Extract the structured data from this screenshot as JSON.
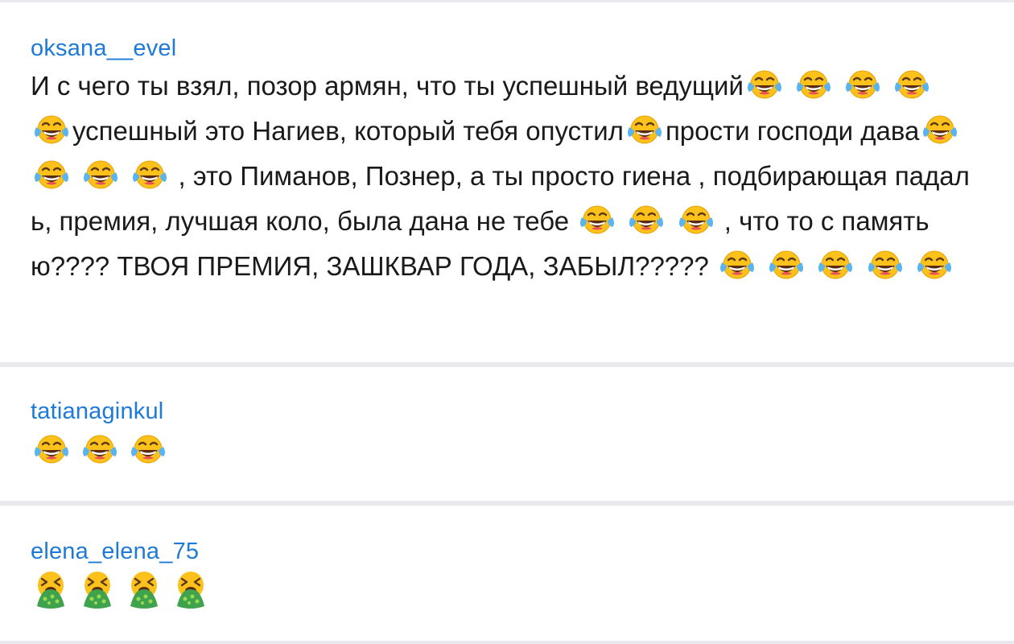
{
  "comments": [
    {
      "username": "oksana__evel",
      "segments": [
        {
          "t": "text",
          "v": "И с чего ты взял, позор армян, что ты успешный ведущий"
        },
        {
          "t": "emoji",
          "v": "face-with-tears-of-joy"
        },
        {
          "t": "text",
          "v": " "
        },
        {
          "t": "emoji",
          "v": "face-with-tears-of-joy"
        },
        {
          "t": "text",
          "v": " "
        },
        {
          "t": "emoji",
          "v": "face-with-tears-of-joy"
        },
        {
          "t": "text",
          "v": " "
        },
        {
          "t": "emoji",
          "v": "face-with-tears-of-joy"
        },
        {
          "t": "text",
          "v": " "
        },
        {
          "t": "emoji",
          "v": "face-with-tears-of-joy"
        },
        {
          "t": "text",
          "v": "успешный это Нагиев, который тебя опустил"
        },
        {
          "t": "emoji",
          "v": "face-with-tears-of-joy"
        },
        {
          "t": "text",
          "v": "прости господи дава"
        },
        {
          "t": "emoji",
          "v": "face-with-tears-of-joy"
        },
        {
          "t": "text",
          "v": " "
        },
        {
          "t": "emoji",
          "v": "face-with-tears-of-joy"
        },
        {
          "t": "text",
          "v": " "
        },
        {
          "t": "emoji",
          "v": "face-with-tears-of-joy"
        },
        {
          "t": "text",
          "v": " "
        },
        {
          "t": "emoji",
          "v": "face-with-tears-of-joy"
        },
        {
          "t": "text",
          "v": " , это Пиманов, Познер, а ты просто гиена , подбирающая падаль, премия, лучшая коло, была дана не тебе "
        },
        {
          "t": "emoji",
          "v": "face-with-tears-of-joy"
        },
        {
          "t": "text",
          "v": " "
        },
        {
          "t": "emoji",
          "v": "face-with-tears-of-joy"
        },
        {
          "t": "text",
          "v": " "
        },
        {
          "t": "emoji",
          "v": "face-with-tears-of-joy"
        },
        {
          "t": "text",
          "v": " , что то с памятью???? ТВОЯ ПРЕМИЯ, ЗАШКВАР ГОДА, ЗАБЫЛ????? "
        },
        {
          "t": "emoji",
          "v": "face-with-tears-of-joy"
        },
        {
          "t": "text",
          "v": " "
        },
        {
          "t": "emoji",
          "v": "face-with-tears-of-joy"
        },
        {
          "t": "text",
          "v": " "
        },
        {
          "t": "emoji",
          "v": "face-with-tears-of-joy"
        },
        {
          "t": "text",
          "v": " "
        },
        {
          "t": "emoji",
          "v": "face-with-tears-of-joy"
        },
        {
          "t": "text",
          "v": " "
        },
        {
          "t": "emoji",
          "v": "face-with-tears-of-joy"
        }
      ]
    },
    {
      "username": "tatianaginkul",
      "emojis": [
        "face-with-tears-of-joy",
        "face-with-tears-of-joy",
        "face-with-tears-of-joy"
      ]
    },
    {
      "username": "elena_elena_75",
      "emojis": [
        "face-vomiting",
        "face-vomiting",
        "face-vomiting",
        "face-vomiting"
      ]
    }
  ],
  "colors": {
    "username": "#1e7ad8",
    "text": "#1a1a1a",
    "divider": "#e9e9ee",
    "background": "#ffffff"
  }
}
